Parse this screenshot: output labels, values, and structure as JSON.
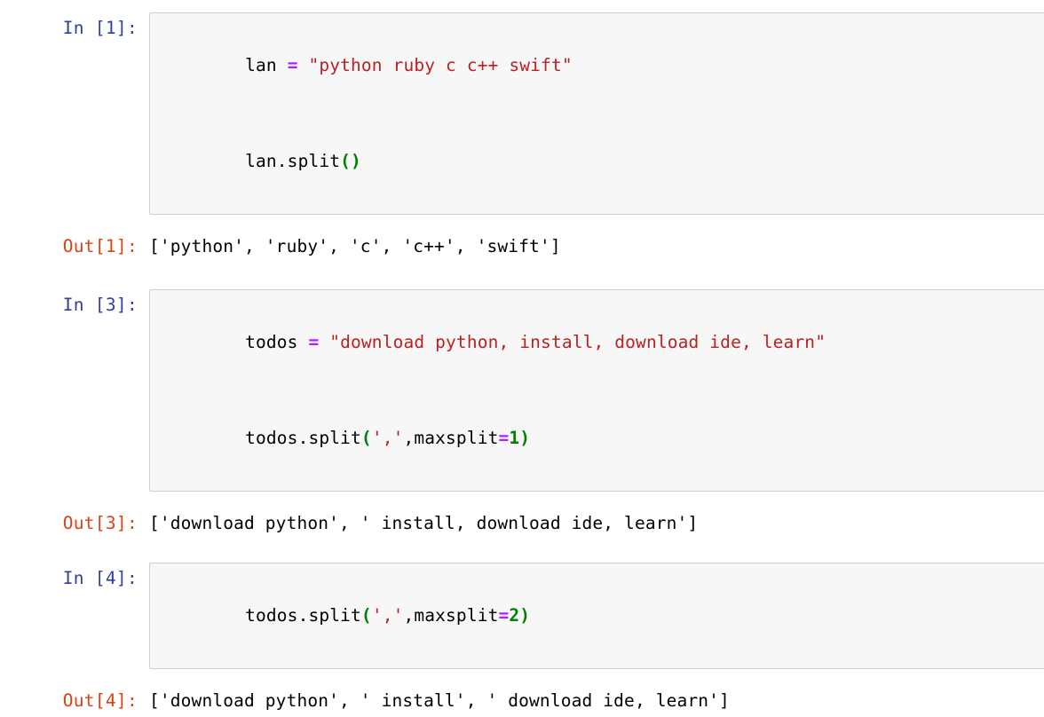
{
  "notebook": {
    "cells": [
      {
        "type": "code",
        "prompt": "In [1]:",
        "source_lines": [
          {
            "tokens": [
              {
                "t": "lan ",
                "k": "plain"
              },
              {
                "t": "=",
                "k": "op"
              },
              {
                "t": " ",
                "k": "plain"
              },
              {
                "t": "\"python ruby c c++ swift\"",
                "k": "str"
              }
            ]
          },
          {
            "tokens": [
              {
                "t": "lan.split",
                "k": "plain"
              },
              {
                "t": "()",
                "k": "punc"
              }
            ]
          }
        ],
        "output": {
          "prompt": "Out[1]:",
          "text": "['python', 'ruby', 'c', 'c++', 'swift']"
        }
      },
      {
        "type": "code",
        "prompt": "In [3]:",
        "source_lines": [
          {
            "tokens": [
              {
                "t": "todos ",
                "k": "plain"
              },
              {
                "t": "=",
                "k": "op"
              },
              {
                "t": " ",
                "k": "plain"
              },
              {
                "t": "\"download python, install, download ide, learn\"",
                "k": "str"
              }
            ]
          },
          {
            "tokens": [
              {
                "t": "todos.split",
                "k": "plain"
              },
              {
                "t": "(",
                "k": "punc"
              },
              {
                "t": "','",
                "k": "str"
              },
              {
                "t": ",maxsplit",
                "k": "plain"
              },
              {
                "t": "=",
                "k": "op"
              },
              {
                "t": "1",
                "k": "num"
              },
              {
                "t": ")",
                "k": "punc"
              }
            ]
          }
        ],
        "output": {
          "prompt": "Out[3]:",
          "text": "['download python', ' install, download ide, learn']"
        }
      },
      {
        "type": "code",
        "prompt": "In [4]:",
        "source_lines": [
          {
            "tokens": [
              {
                "t": "todos.split",
                "k": "plain"
              },
              {
                "t": "(",
                "k": "punc"
              },
              {
                "t": "','",
                "k": "str"
              },
              {
                "t": ",maxsplit",
                "k": "plain"
              },
              {
                "t": "=",
                "k": "op"
              },
              {
                "t": "2",
                "k": "num"
              },
              {
                "t": ")",
                "k": "punc"
              }
            ]
          }
        ],
        "output": {
          "prompt": "Out[4]:",
          "text": "['download python', ' install', ' download ide, learn']"
        }
      }
    ]
  },
  "colors": {
    "prompt_in": "#303F9F",
    "prompt_out": "#D84315",
    "string": "#BA2121",
    "operator": "#AA22FF",
    "punctuation": "#008000",
    "number": "#008000",
    "text": "#000000",
    "input_background": "#f7f7f7",
    "input_border": "#cfcfcf",
    "page_background": "#ffffff"
  }
}
